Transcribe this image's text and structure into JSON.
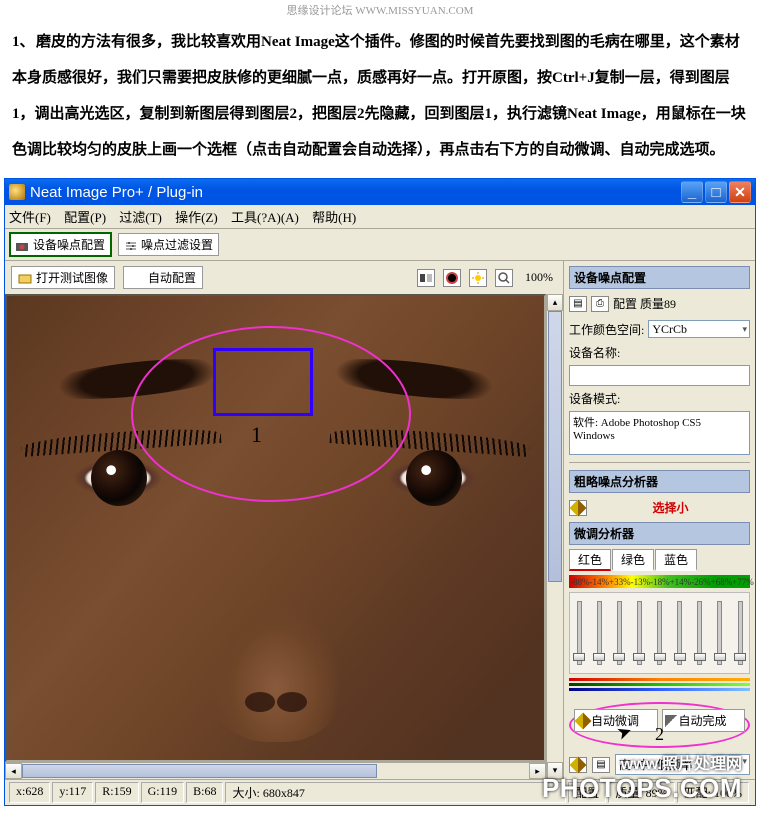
{
  "header_watermark": "思缘设计论坛   WWW.MISSYUAN.COM",
  "intro_num": "1、",
  "intro_text": "磨皮的方法有很多，我比较喜欢用Neat Image这个插件。修图的时候首先要找到图的毛病在哪里，这个素材本身质感很好，我们只需要把皮肤修的更细腻一点，质感再好一点。打开原图，按Ctrl+J复制一层，得到图层1，调出高光选区，复制到新图层得到图层2，把图层2先隐藏，回到图层1，执行滤镜Neat Image，用鼠标在一块色调比较均匀的皮肤上画一个选框（点击自动配置会自动选择），再点击右下方的自动微调、自动完成选项。",
  "title": "Neat Image Pro+ / Plug-in",
  "menu": {
    "file": "文件(F)",
    "config": "配置(P)",
    "filter": "过滤(T)",
    "op": "操作(Z)",
    "tool": "工具(?A)(A)",
    "help": "帮助(H)"
  },
  "tabs": {
    "device": "设备噪点配置",
    "noise": "噪点过滤设置"
  },
  "toolbar": {
    "open": "打开测试图像",
    "auto": "自动配置"
  },
  "zoom": "100%",
  "sel_label": "1",
  "right": {
    "panel1_title": "设备噪点配置",
    "cfg_quality": "配置 质量89",
    "workspace_label": "工作颜色空间:",
    "workspace_value": "YCrCb",
    "devname_label": "设备名称:",
    "devname_value": "",
    "devmode_label": "设备模式:",
    "devmode_value": "软件: Adobe Photoshop CS5\nWindows",
    "rough_title": "粗略噪点分析器",
    "rough_warn": "选择小",
    "fine_title": "微调分析器",
    "tab_r": "红色",
    "tab_g": "绿色",
    "tab_b": "蓝色",
    "bar_vals": [
      "-88%",
      "-14%",
      "+33%",
      "-13%",
      "-18%",
      "+14%",
      "-26%",
      "+68%",
      "+77%"
    ],
    "auto_tune": "自动微调",
    "auto_done": "自动完成",
    "label2": "2",
    "freq": "高+中+低频率"
  },
  "status": {
    "x": "x:628",
    "y": "y:117",
    "r": "R:159",
    "g": "G:119",
    "b": "B:68",
    "size": "大小: 680x847",
    "cfg": "配置",
    "quality": "质量: 89%",
    "match": "匹配: 100%"
  },
  "watermark": {
    "l1": "www.照片处理网",
    "l2": "PHOTOPS.COM"
  }
}
